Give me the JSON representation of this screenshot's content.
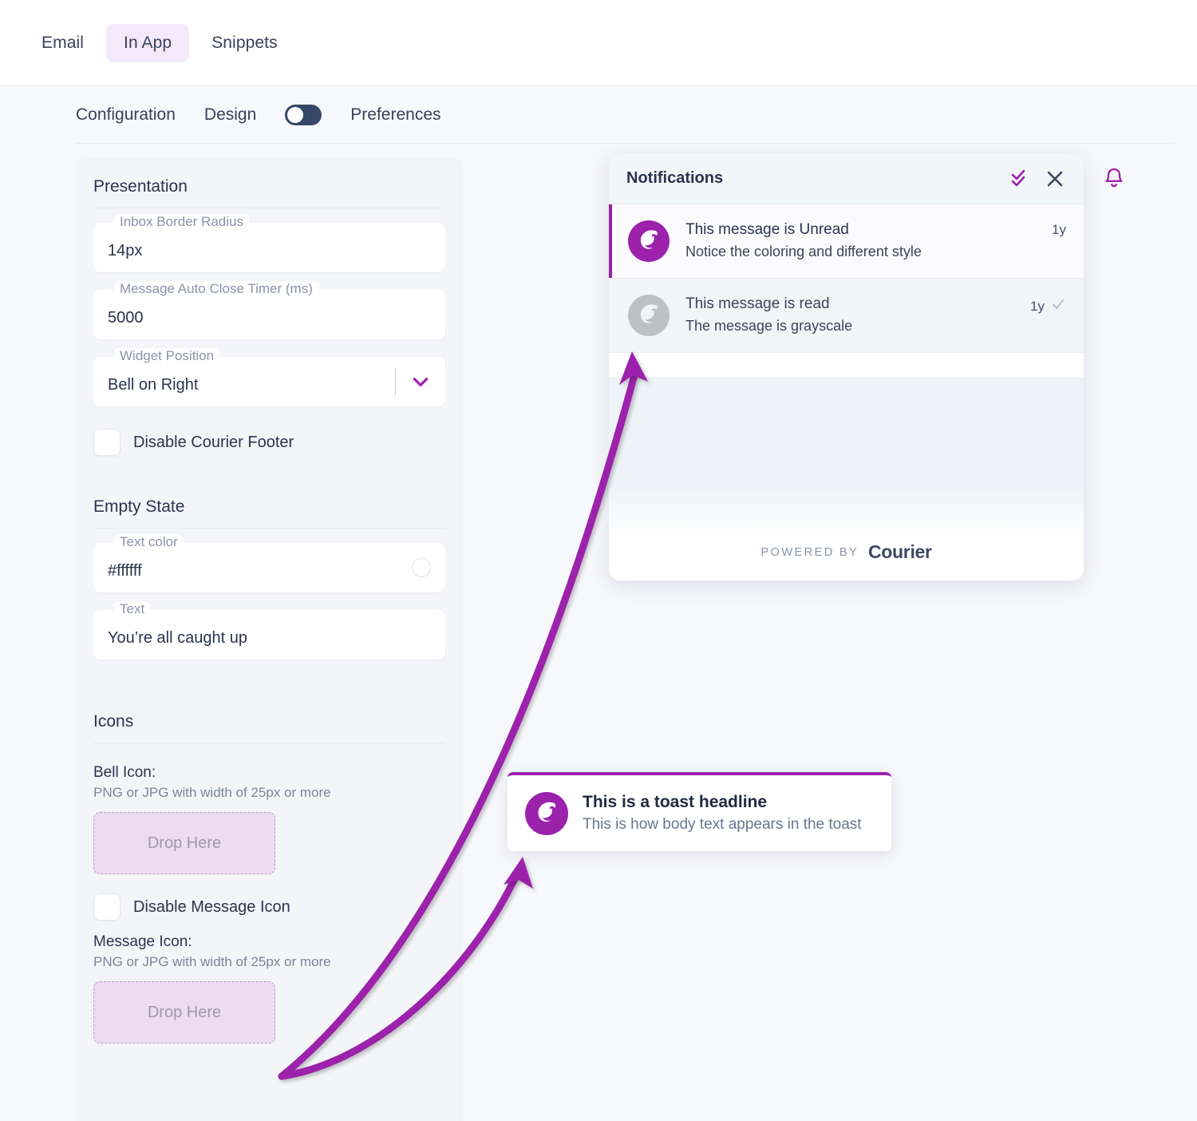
{
  "topbar": {
    "tabs": [
      {
        "label": "Email",
        "active": false
      },
      {
        "label": "In App",
        "active": true
      },
      {
        "label": "Snippets",
        "active": false
      }
    ]
  },
  "subnav": {
    "configuration": "Configuration",
    "design": "Design",
    "preferences": "Preferences",
    "toggle_state": "off"
  },
  "config": {
    "presentation": {
      "heading": "Presentation",
      "inbox_border_radius": {
        "label": "Inbox Border Radius",
        "value": "14px"
      },
      "auto_close_timer": {
        "label": "Message Auto Close Timer (ms)",
        "value": "5000"
      },
      "widget_position": {
        "label": "Widget Position",
        "value": "Bell on Right",
        "icon": "chevron-down-icon"
      },
      "disable_courier_footer": {
        "label": "Disable Courier Footer",
        "checked": false
      }
    },
    "empty_state": {
      "heading": "Empty State",
      "text_color": {
        "label": "Text color",
        "value": "#ffffff",
        "swatch": "#ffffff"
      },
      "text": {
        "label": "Text",
        "value": "You’re all caught up"
      }
    },
    "icons": {
      "heading": "Icons",
      "bell_icon": {
        "label": "Bell Icon:",
        "hint": "PNG or JPG with width of 25px or more",
        "drop_label": "Drop Here"
      },
      "disable_message_icon": {
        "label": "Disable Message Icon",
        "checked": false
      },
      "message_icon": {
        "label": "Message Icon:",
        "hint": "PNG or JPG with width of 25px or more",
        "drop_label": "Drop Here"
      }
    }
  },
  "inbox": {
    "title": "Notifications",
    "mark_all_read_icon": "double-check-icon",
    "close_icon": "close-icon",
    "bell_icon": "bell-icon",
    "messages": [
      {
        "title": "This message is Unread",
        "body": "Notice the coloring and different style",
        "time": "1y",
        "state": "unread"
      },
      {
        "title": "This message is read",
        "body": "The message is grayscale",
        "time": "1y",
        "state": "read"
      }
    ],
    "footer": {
      "powered_by": "POWERED BY",
      "brand": "Courier"
    }
  },
  "toast": {
    "headline": "This is a toast headline",
    "body": "This is how body text appears in the toast",
    "icon": "courier-bird-icon"
  },
  "colors": {
    "accent_purple": "#9c21ab",
    "tab_active_bg": "#f4e9fa",
    "toggle_bg": "#344767",
    "drop_zone_bg": "#eddaf3",
    "page_bg": "#f7f8fb",
    "panel_bg": "#f4f5f8",
    "text_dark": "#2c3350",
    "text_muted": "#8c93a8",
    "annotation_arrow": "#9c21ab"
  }
}
